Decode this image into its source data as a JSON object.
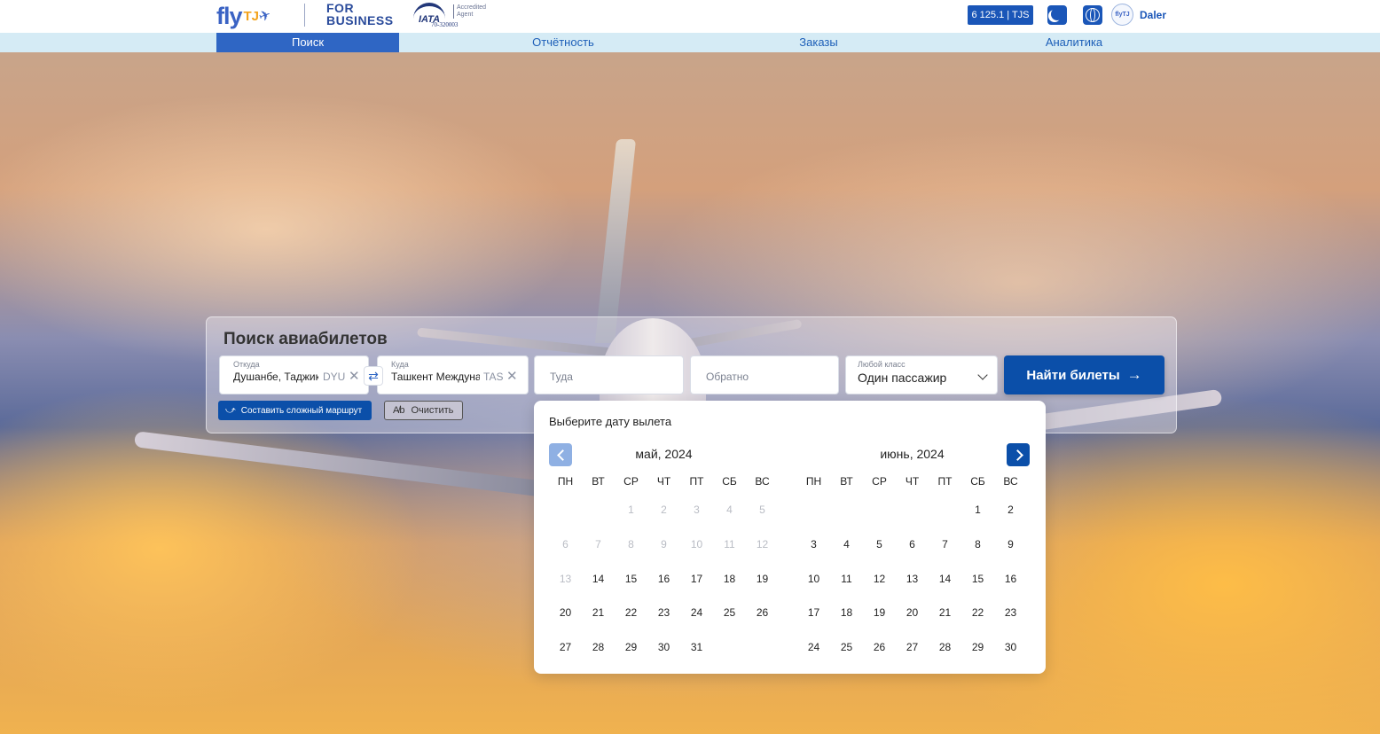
{
  "header": {
    "logo_text": "fly",
    "logo_suffix": "TJ",
    "for_business": [
      "FOR",
      "BUSINESS"
    ],
    "iata_mark": "IATA",
    "iata_accredited": [
      "Accredited",
      "Agent"
    ],
    "iata_code": "70-320003",
    "balance": "6 125.1 | TJS",
    "avatar_text": "flyTJ",
    "username": "Daler"
  },
  "nav": {
    "tabs": [
      {
        "label": "Поиск",
        "active": true
      },
      {
        "label": "Отчётность",
        "active": false
      },
      {
        "label": "Заказы",
        "active": false
      },
      {
        "label": "Аналитика",
        "active": false
      }
    ]
  },
  "search": {
    "title": "Поиск авиабилетов",
    "from": {
      "label": "Откуда",
      "value": "Душанбе, Таджикистан",
      "code": "DYU"
    },
    "to": {
      "label": "Куда",
      "value": "Ташкент Международный",
      "code": "TAS"
    },
    "depart_placeholder": "Туда",
    "return_placeholder": "Обратно",
    "class_label": "Любой класс",
    "passengers": "Один пассажир",
    "find_button": "Найти билеты",
    "complex_route_button": "Составить сложный маршрут",
    "clear_button": "Очистить"
  },
  "calendar": {
    "title": "Выберите дату вылета",
    "weekdays": [
      "ПН",
      "ВТ",
      "СР",
      "ЧТ",
      "ПТ",
      "СБ",
      "ВС"
    ],
    "months": [
      {
        "name": "май, 2024",
        "offset": 2,
        "days": 31,
        "disabled_until": 14
      },
      {
        "name": "июнь, 2024",
        "offset": 5,
        "days": 30,
        "disabled_until": 0
      }
    ]
  },
  "colors": {
    "brand_blue": "#0b4fa9",
    "nav_active": "#2f66c4",
    "nav_bg": "#d5ebf5"
  }
}
